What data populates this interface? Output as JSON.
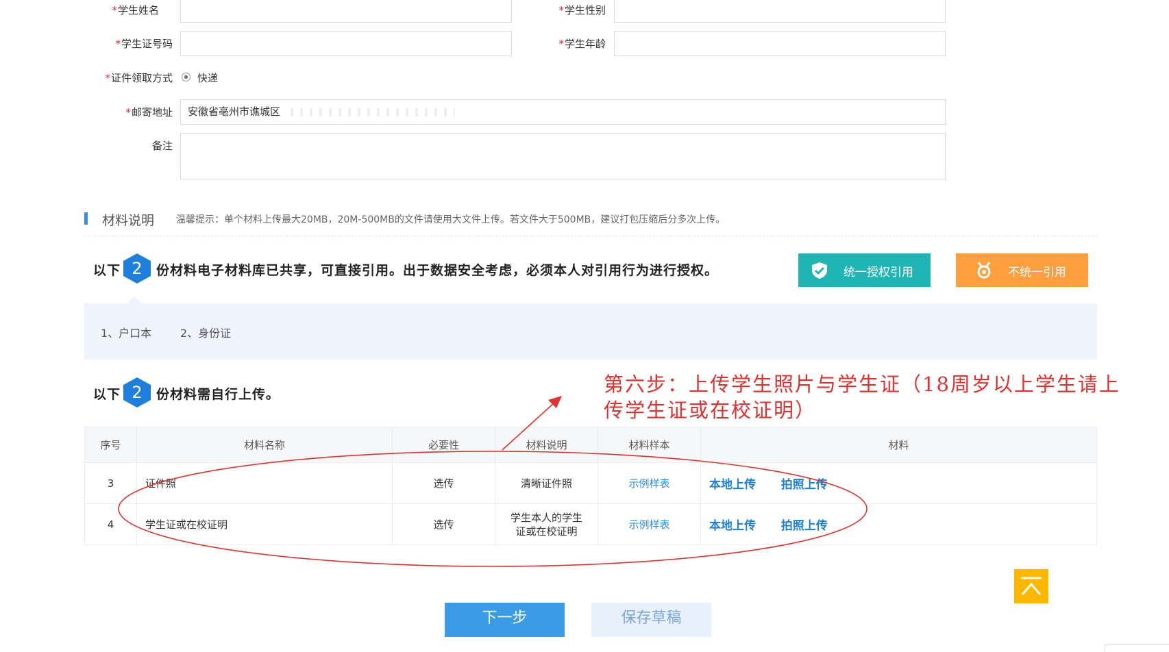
{
  "form": {
    "student_name_label": "学生姓名",
    "student_gender_label": "学生性别",
    "student_id_label": "学生证号码",
    "student_age_label": "学生年龄",
    "pickup_method_label": "证件领取方式",
    "pickup_method_option": "快递",
    "mail_address_label": "邮寄地址",
    "mail_address_value": "安徽省亳州市谯城区",
    "remark_label": "备注",
    "required_mark": "*"
  },
  "materials": {
    "section_title": "材料说明",
    "tip": "温馨提示：单个材料上传最大20MB，20M-500MB的文件请使用大文件上传。若文件大于500MB，建议打包压缩后分多次上传。",
    "shared_prefix": "以下",
    "shared_count": "2",
    "shared_text": "份材料电子材料库已共享，可直接引用。出于数据安全考虑，必须本人对引用行为进行授权。",
    "btn_unified": "统一授权引用",
    "btn_not_unified": "不统一引用",
    "shared_items": [
      "1、户口本",
      "2、身份证"
    ],
    "upload_prefix": "以下",
    "upload_count": "2",
    "upload_text": "份材料需自行上传。"
  },
  "table": {
    "headers": [
      "序号",
      "材料名称",
      "必要性",
      "材料说明",
      "材料样本",
      "材料"
    ],
    "rows": [
      {
        "no": "3",
        "name": "证件照",
        "necessity": "选传",
        "desc": "清晰证件照",
        "sample": "示例样表",
        "local": "本地上传",
        "photo": "拍照上传"
      },
      {
        "no": "4",
        "name": "学生证或在校证明",
        "necessity": "选传",
        "desc": "学生本人的学生证或在校证明",
        "sample": "示例样表",
        "local": "本地上传",
        "photo": "拍照上传"
      }
    ]
  },
  "annotation": {
    "line1": "第六步：上传学生照片与学生证（18周岁以上学生请上",
    "line2": "传学生证或在校证明）",
    "color": "#e0312e"
  },
  "footer": {
    "next_button": "下一步",
    "save_draft_button": "保存草稿"
  },
  "colors": {
    "accent_blue": "#3a9be7",
    "green": "#1fb5b5",
    "orange": "#ff9e3d",
    "top_button": "#ffb800"
  },
  "icons": {
    "unified": "shield-check-icon",
    "not_unified": "badge-icon",
    "back_to_top": "back-to-top-icon"
  }
}
